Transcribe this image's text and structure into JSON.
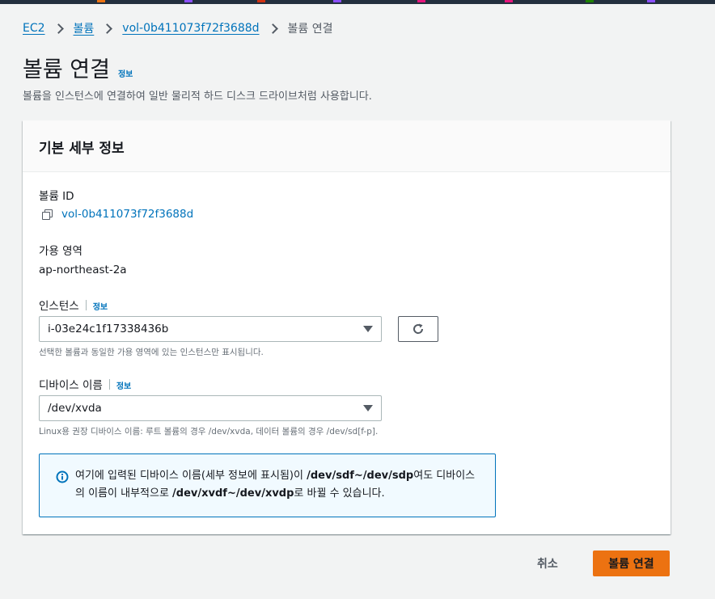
{
  "breadcrumb": {
    "items": [
      "EC2",
      "볼륨",
      "vol-0b411073f72f3688d"
    ],
    "current": "볼륨 연결"
  },
  "page": {
    "title": "볼륨 연결",
    "info": "정보",
    "description": "볼륨을 인스턴스에 연결하여 일반 물리적 하드 디스크 드라이브처럼 사용합니다."
  },
  "panel": {
    "title": "기본 세부 정보",
    "volume_id_label": "볼륨 ID",
    "volume_id": "vol-0b411073f72f3688d",
    "az_label": "가용 영역",
    "az_value": "ap-northeast-2a",
    "instance_label": "인스턴스",
    "instance_info": "정보",
    "instance_value": "i-03e24c1f17338436b",
    "instance_hint": "선택한 볼륨과 동일한 가용 영역에 있는 인스턴스만 표시됩니다.",
    "device_label": "디바이스 이름",
    "device_info": "정보",
    "device_value": "/dev/xvda",
    "device_hint": "Linux용 권장 디바이스 이름: 루트 볼륨의 경우 /dev/xvda, 데이터 볼륨의 경우 /dev/sd[f-p]."
  },
  "alert": {
    "t1": "여기에 입력된 디바이스 이름(세부 정보에 표시됨)이 ",
    "b1": "/dev/sdf~/dev/sdp",
    "t2": "여도 디바이스의 이름이 내부적으로 ",
    "b2": "/dev/xvdf~/dev/xvdp",
    "t3": "로 바뀔 수 있습니다."
  },
  "footer": {
    "cancel": "취소",
    "submit": "볼륨 연결"
  },
  "colors": {
    "link": "#0073bb",
    "primary": "#ec7211",
    "alert_bg": "#f1faff",
    "background": "#f2f3f3"
  }
}
